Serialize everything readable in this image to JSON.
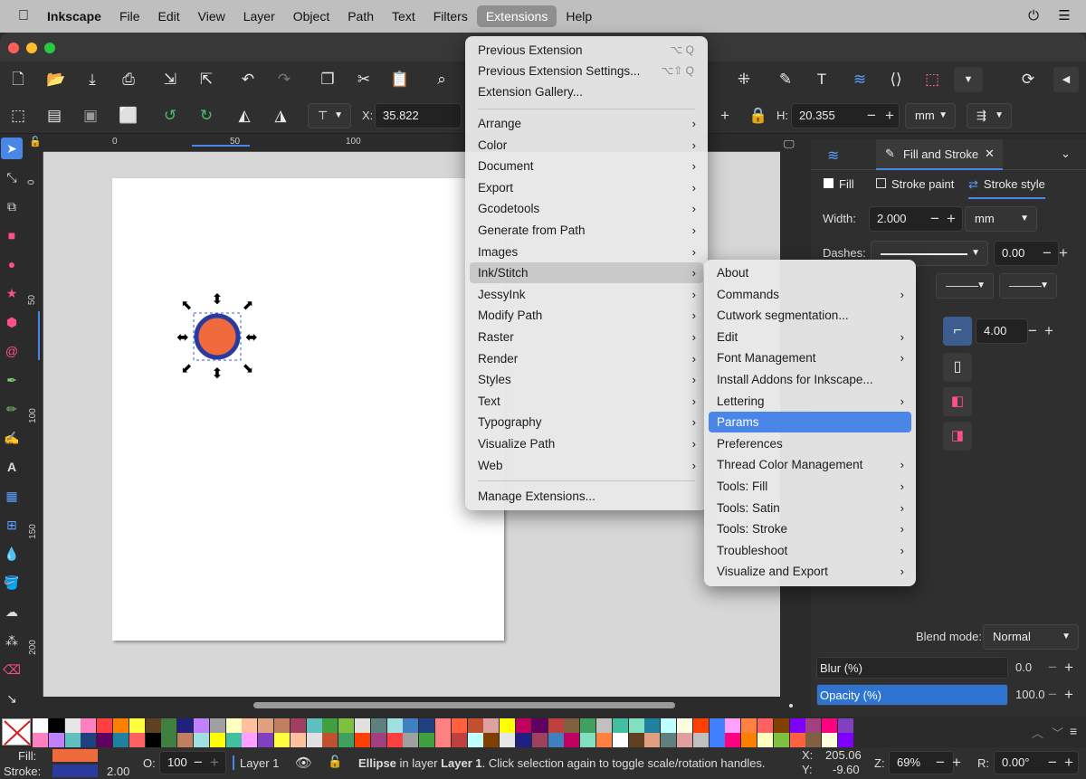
{
  "menubar": {
    "app_name": "Inkscape",
    "items": [
      "File",
      "Edit",
      "View",
      "Layer",
      "Object",
      "Path",
      "Text",
      "Filters",
      "Extensions",
      "Help"
    ],
    "active": "Extensions"
  },
  "controls": {
    "x_label": "X:",
    "x_value": "35.822",
    "h_label": "H:",
    "h_value": "20.355",
    "unit": "mm"
  },
  "ruler": {
    "h_ticks": [
      "0",
      "50",
      "100"
    ],
    "v_ticks": [
      "0",
      "50",
      "100",
      "150",
      "200"
    ]
  },
  "extensions_menu": {
    "top": [
      {
        "label": "Previous Extension",
        "shortcut": "⌥ Q"
      },
      {
        "label": "Previous Extension Settings...",
        "shortcut": "⌥⇧ Q"
      },
      {
        "label": "Extension Gallery...",
        "shortcut": ""
      }
    ],
    "submenus": [
      "Arrange",
      "Color",
      "Document",
      "Export",
      "Gcodetools",
      "Generate from Path",
      "Images",
      "Ink/Stitch",
      "JessyInk",
      "Modify Path",
      "Raster",
      "Render",
      "Styles",
      "Text",
      "Typography",
      "Visualize Path",
      "Web"
    ],
    "highlighted": "Ink/Stitch",
    "bottom": "Manage Extensions..."
  },
  "inkstitch_menu": {
    "items": [
      {
        "label": "About",
        "submenu": false
      },
      {
        "label": "Commands",
        "submenu": true
      },
      {
        "label": "Cutwork segmentation...",
        "submenu": false
      },
      {
        "label": "Edit",
        "submenu": true
      },
      {
        "label": "Font Management",
        "submenu": true
      },
      {
        "label": "Install Addons for Inkscape...",
        "submenu": false
      },
      {
        "label": "Lettering",
        "submenu": true
      },
      {
        "label": "Params",
        "submenu": false
      },
      {
        "label": "Preferences",
        "submenu": false
      },
      {
        "label": "Thread Color Management",
        "submenu": true
      },
      {
        "label": "Tools: Fill",
        "submenu": true
      },
      {
        "label": "Tools: Satin",
        "submenu": true
      },
      {
        "label": "Tools: Stroke",
        "submenu": true
      },
      {
        "label": "Troubleshoot",
        "submenu": true
      },
      {
        "label": "Visualize and Export",
        "submenu": true
      }
    ],
    "selected": "Params"
  },
  "panel": {
    "tab_title": "Fill and Stroke",
    "subtabs": [
      "Fill",
      "Stroke paint",
      "Stroke style"
    ],
    "active_subtab": "Stroke style",
    "width_label": "Width:",
    "width_value": "2.000",
    "width_unit": "mm",
    "dashes_label": "Dashes:",
    "dashes_value": "0.00",
    "miter_value": "4.00",
    "blend_label": "Blend mode:",
    "blend_value": "Normal",
    "blur_label": "Blur (%)",
    "blur_value": "0.0",
    "opacity_label": "Opacity (%)",
    "opacity_value": "100.0"
  },
  "status": {
    "fill_label": "Fill:",
    "stroke_label": "Stroke:",
    "stroke_width": "2.00",
    "opacity_label": "O:",
    "opacity_value": "100",
    "layer": "Layer 1",
    "object_type": "Ellipse",
    "message_mid": "in layer",
    "message_layer": "Layer 1",
    "message_end": ". Click selection again to toggle scale/rotation handles.",
    "x_label": "X:",
    "x_value": "205.06",
    "y_label": "Y:",
    "y_value": "-9.60",
    "zoom_label": "Z:",
    "zoom_value": "69%",
    "rotation_label": "R:",
    "rotation_value": "0.00°"
  },
  "colors": {
    "fill": "#ef6a3d",
    "stroke": "#2b3a9e",
    "selection_accent": "#4a86e8",
    "palette": [
      "#ffffff",
      "#000000",
      "#e6e6e6",
      "#ff80c0",
      "#ff4040",
      "#ff8000",
      "#ffff40",
      "#604020",
      "#3f7f3f",
      "#202080",
      "#c080ff",
      "#a0a0a0",
      "#ffffc0",
      "#ffc0a0",
      "#e0a080",
      "#c08060",
      "#a04060",
      "#60c0c0",
      "#40a040",
      "#80c040",
      "#e0e0e0",
      "#608080",
      "#a0e0e0",
      "#4080c0",
      "#204080",
      "#ff8080",
      "#ff6040",
      "#c05030",
      "#e0a0a0",
      "#ffff00",
      "#c00060",
      "#600060",
      "#c04040",
      "#806040",
      "#40a060",
      "#c0c0c0",
      "#40c0a0",
      "#80e0c0",
      "#2080a0",
      "#c0ffff",
      "#ffffe0",
      "#ff4000",
      "#4080ff",
      "#ffa0ff",
      "#ff8040",
      "#ff6060",
      "#804000",
      "#8000ff",
      "#a04080",
      "#ff0080",
      "#8040c0"
    ]
  }
}
